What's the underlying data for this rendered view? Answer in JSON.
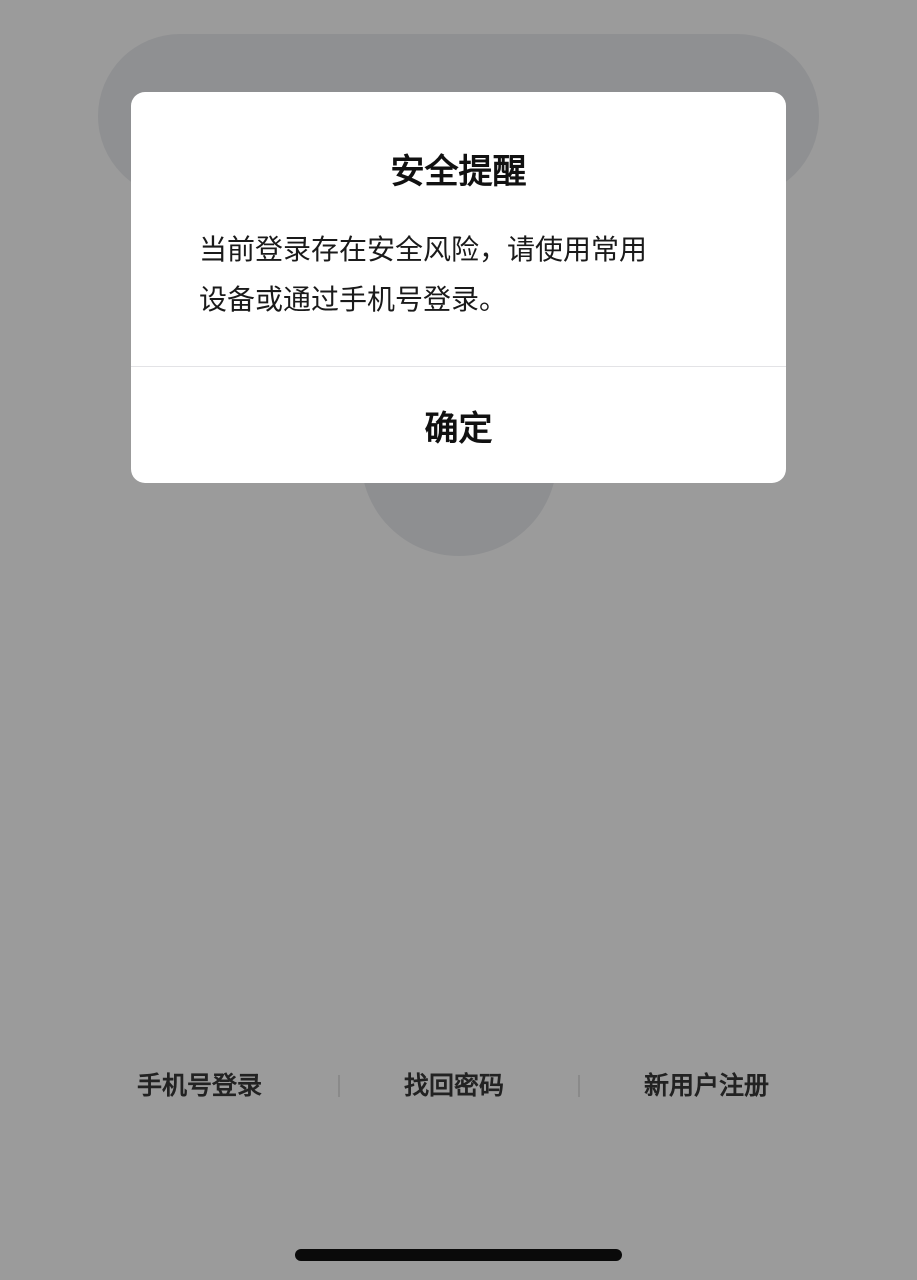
{
  "dialog": {
    "title": "安全提醒",
    "message_line1": "当前登录存在安全风险，请使用常用",
    "message_line2": "设备或通过手机号登录。",
    "confirm_label": "确定"
  },
  "bottom_links": {
    "phone_login": "手机号登录",
    "recover_password": "找回密码",
    "new_user_register": "新用户注册",
    "separator": "|"
  },
  "colors": {
    "overlay_background": "#9b9b9b",
    "dialog_background": "#ffffff",
    "text_primary": "#111111"
  }
}
